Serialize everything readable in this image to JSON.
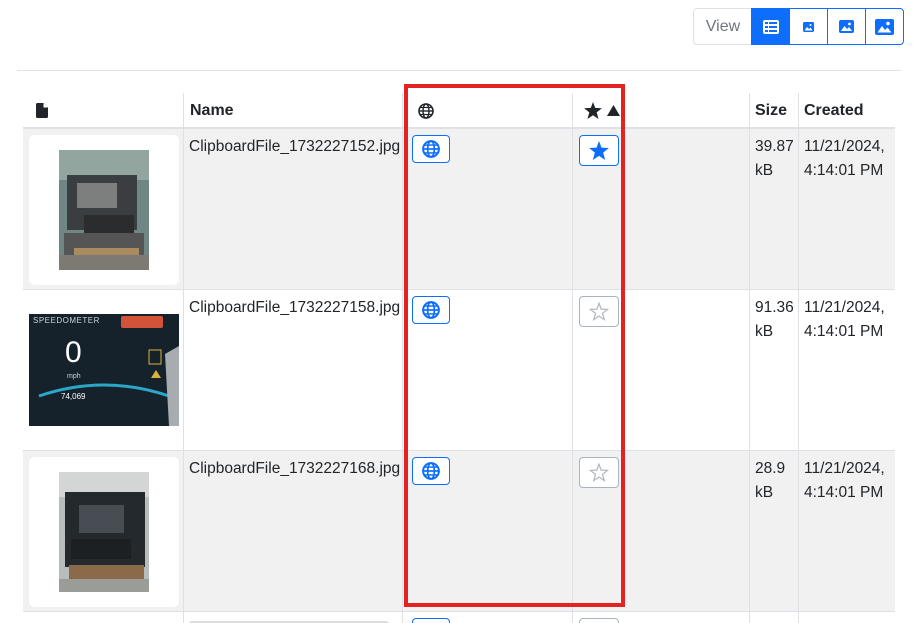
{
  "toolbar": {
    "view_label": "View",
    "buttons": [
      {
        "icon": "list-icon",
        "active": true
      },
      {
        "icon": "image-small-icon",
        "active": false
      },
      {
        "icon": "image-medium-icon",
        "active": false
      },
      {
        "icon": "image-large-icon",
        "active": false
      }
    ]
  },
  "table": {
    "headers": {
      "file": "",
      "name": "Name",
      "public": "",
      "favorite": "",
      "size": "Size",
      "created": "Created"
    },
    "rows": [
      {
        "name": "ClipboardFile_1732227152.jpg",
        "size_1": "39.87",
        "size_2": "kB",
        "created_1": "11/21/2024,",
        "created_2": "4:14:01 PM",
        "favorite": true
      },
      {
        "name": "ClipboardFile_1732227158.jpg",
        "size_1": "91.36",
        "size_2": "kB",
        "created_1": "11/21/2024,",
        "created_2": "4:14:01 PM",
        "favorite": false,
        "thumb_text": "SPEEDOMETER",
        "thumb_value": "0",
        "thumb_unit": "mph",
        "thumb_odo": "74,069"
      },
      {
        "name": "ClipboardFile_1732227168.jpg",
        "size_1": "28.9",
        "size_2": "kB",
        "created_1": "11/21/2024,",
        "created_2": "4:14:01 PM",
        "favorite": false
      }
    ]
  },
  "colors": {
    "accent": "#0d6efd",
    "highlight": "#e32222",
    "row_gray": "#f1f1f1"
  }
}
